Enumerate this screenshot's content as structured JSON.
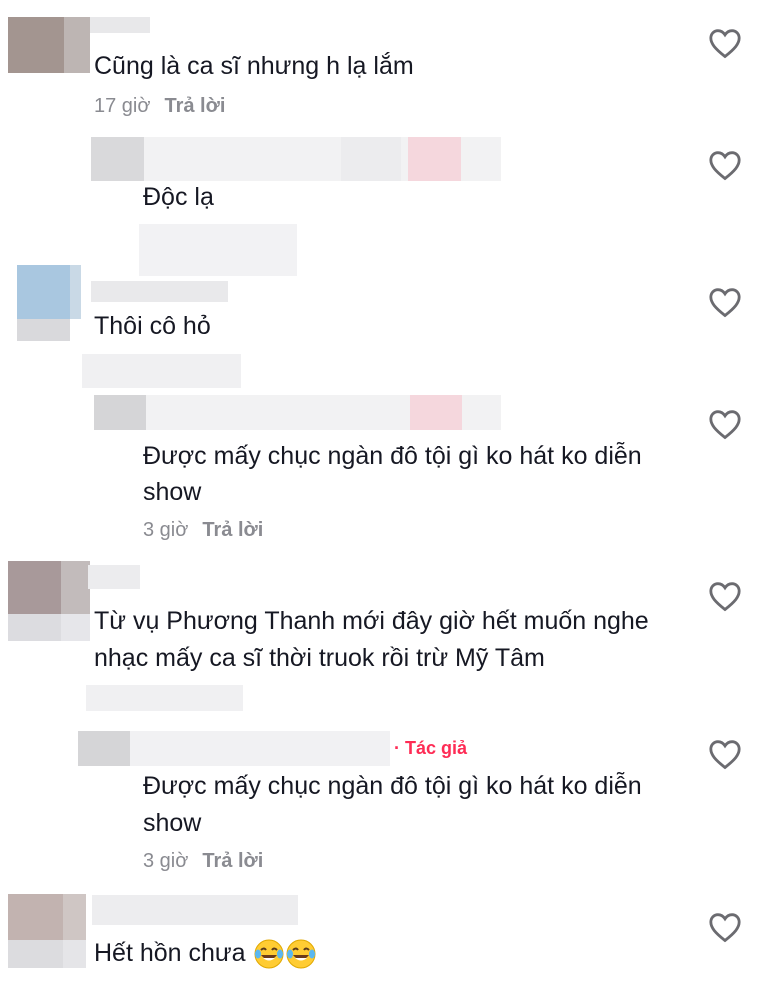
{
  "comments": [
    {
      "text": "Cũng là ca sĩ nhưng h lạ lắm",
      "time": "17 giờ",
      "reply": "Trả lời"
    },
    {
      "text": "Độc lạ"
    },
    {
      "text": "Thôi cô hỏ"
    },
    {
      "text_line1": "Được mấy chục ngàn đô tội gì ko hát ko diễn",
      "text_line2": "show",
      "time": "3 giờ",
      "reply": "Trả lời"
    },
    {
      "text_line1": "Từ vụ Phương Thanh mới đây giờ hết muốn nghe",
      "text_line2": "nhạc mấy ca sĩ thời truok rồi trừ Mỹ Tâm"
    },
    {
      "author_badge": "· Tác giả",
      "text_line1": "Được mấy chục ngàn đô tội gì ko hát ko diễn",
      "text_line2": "show",
      "time": "3 giờ",
      "reply": "Trả lời"
    },
    {
      "text": "Hết hồn chưa",
      "emoji": "laughing-with-tears x2"
    }
  ],
  "colors": {
    "text": "#161823",
    "meta": "#8a8b91",
    "accent": "#fe2c55",
    "heart_stroke": "#6b6b70"
  },
  "icons": {
    "like": "heart-outline-icon",
    "emoji": "face-with-tears-of-joy-icon"
  }
}
